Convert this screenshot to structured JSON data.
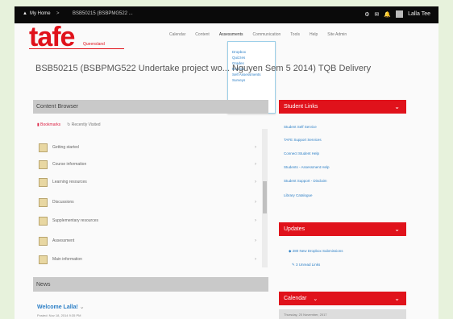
{
  "topbar": {
    "home": "My Home",
    "crumb_sep": ">",
    "course_short": "BSB50215 (BSBPMG522 ...",
    "right_icons": [
      "gear-icon",
      "mail-icon",
      "bell-icon"
    ],
    "user": "Lalla Tee"
  },
  "brand": {
    "logo": "tafe",
    "sub": "Queensland",
    "accent": "#e0121b"
  },
  "nav": {
    "items": [
      "Calendar",
      "Content",
      "Assessments",
      "Communication",
      "Tools",
      "Help",
      "Site Admin"
    ],
    "active": "Assessments"
  },
  "dropdown": {
    "items": [
      "Dropbox",
      "Quizzes",
      "Grades",
      "Rubrics",
      "Self Assessments",
      "Surveys"
    ]
  },
  "title": "BSB50215 (BSBPMG522 Undertake project wo... Nguyen Sem 5 2014) TQB Delivery",
  "content_browser": {
    "header": "Content Browser",
    "bookmarks": "Bookmarks",
    "recent": "Recently Visited",
    "items": [
      "Getting started",
      "Course information",
      "Learning resources",
      "Discussions",
      "Supplementary resources",
      "Assessment",
      "Main information"
    ]
  },
  "news": {
    "header": "News",
    "welcome": "Welcome Lalla!",
    "sub": "Posted: Nov 18, 2014 9:35 PM"
  },
  "student_links": {
    "header": "Student Links",
    "items": [
      "Student Self Service",
      "TAFE Support Services",
      "Connect Student Help",
      "Students - Assessment Help",
      "Student Support - Disclaim",
      "Library Catalogue"
    ]
  },
  "updates": {
    "header": "Updates",
    "items": [
      "280 New Dropbox Submissions",
      "3 Unread Links"
    ]
  },
  "calendar": {
    "header": "Calendar",
    "date": "Thursday, 20 November, 2017"
  }
}
